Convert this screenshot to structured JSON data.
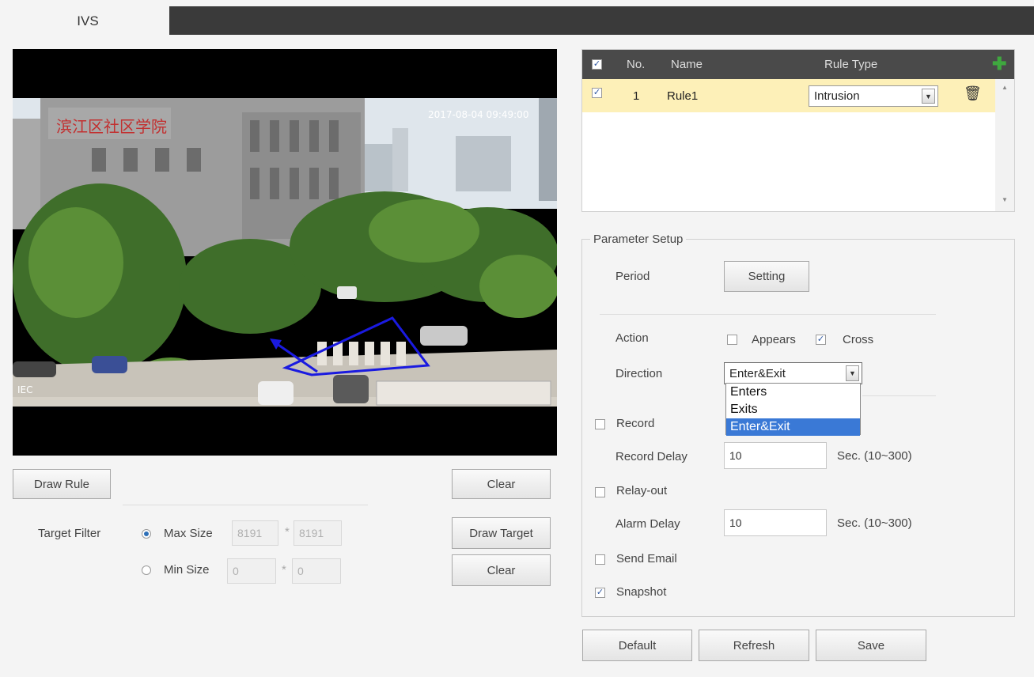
{
  "tab": {
    "label": "IVS"
  },
  "video": {
    "timestamp": "2017-08-04 09:49:00",
    "sign_text": "滨江区社区学院",
    "channel_label": "IEC"
  },
  "left_controls": {
    "draw_rule": "Draw Rule",
    "clear_top": "Clear",
    "target_filter_label": "Target Filter",
    "max_size_label": "Max Size",
    "max_w": "8191",
    "max_h": "8191",
    "min_size_label": "Min Size",
    "min_w": "0",
    "min_h": "0",
    "times": "*",
    "draw_target": "Draw Target",
    "clear_bottom": "Clear"
  },
  "rule_table": {
    "headers": {
      "no": "No.",
      "name": "Name",
      "rule_type": "Rule Type"
    },
    "rows": [
      {
        "no": "1",
        "name": "Rule1",
        "rule_type": "Intrusion",
        "checked": true
      }
    ]
  },
  "params": {
    "legend": "Parameter Setup",
    "period_label": "Period",
    "setting_button": "Setting",
    "action_label": "Action",
    "appears_label": "Appears",
    "appears_checked": false,
    "cross_label": "Cross",
    "cross_checked": true,
    "direction_label": "Direction",
    "direction_value": "Enter&Exit",
    "direction_options": [
      "Enters",
      "Exits",
      "Enter&Exit"
    ],
    "record_label": "Record",
    "record_checked": false,
    "record_delay_label": "Record Delay",
    "record_delay_value": "10",
    "record_delay_unit": "Sec. (10~300)",
    "relay_out_label": "Relay-out",
    "relay_out_checked": false,
    "alarm_delay_label": "Alarm Delay",
    "alarm_delay_value": "10",
    "alarm_delay_unit": "Sec. (10~300)",
    "send_email_label": "Send Email",
    "send_email_checked": false,
    "snapshot_label": "Snapshot",
    "snapshot_checked": true
  },
  "footer": {
    "default": "Default",
    "refresh": "Refresh",
    "save": "Save"
  },
  "colors": {
    "accent_green": "#3fa83f",
    "row_highlight": "#fdf0b8",
    "selected_option": "#3a79d6",
    "rule_line": "#1a1ae0"
  }
}
